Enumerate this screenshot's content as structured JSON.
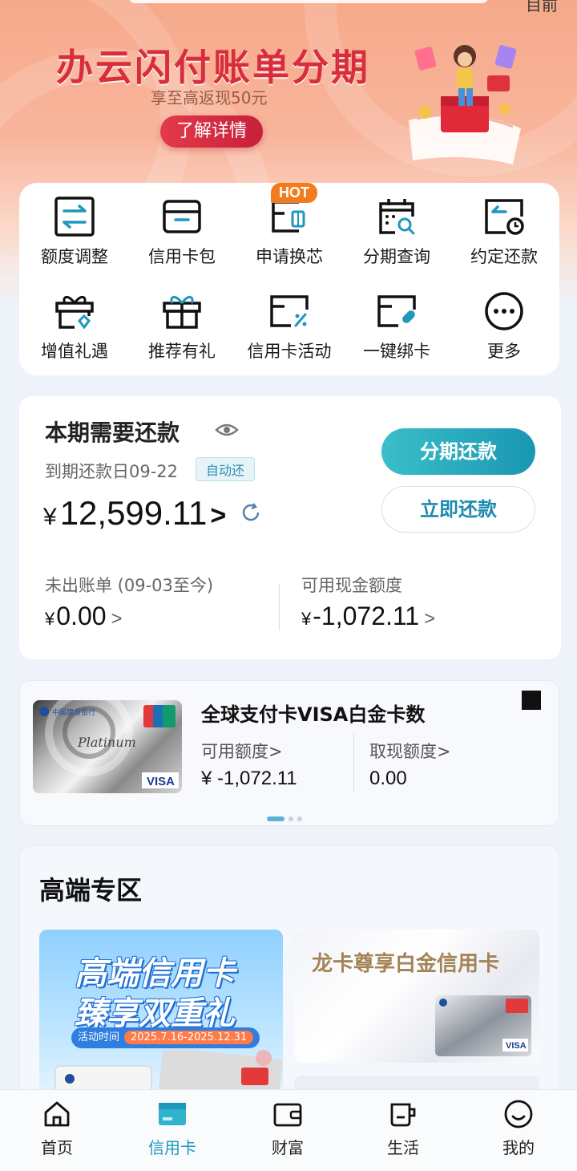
{
  "banner": {
    "title": "办云闪付账单分期",
    "subtitle": "享至高返现50元",
    "button": "了解详情",
    "top_right": "目前"
  },
  "quick_actions": {
    "hot_badge": "HOT",
    "items": [
      {
        "label": "额度调整",
        "icon": "limit-adjust-icon"
      },
      {
        "label": "信用卡包",
        "icon": "card-wallet-icon"
      },
      {
        "label": "申请换芯",
        "icon": "chip-replace-icon"
      },
      {
        "label": "分期查询",
        "icon": "installment-query-icon"
      },
      {
        "label": "约定还款",
        "icon": "scheduled-repay-icon"
      },
      {
        "label": "增值礼遇",
        "icon": "gift-benefit-icon"
      },
      {
        "label": "推荐有礼",
        "icon": "referral-gift-icon"
      },
      {
        "label": "信用卡活动",
        "icon": "card-promo-icon"
      },
      {
        "label": "一键绑卡",
        "icon": "bind-card-icon"
      },
      {
        "label": "更多",
        "icon": "more-icon"
      }
    ]
  },
  "repayment": {
    "title": "本期需要还款",
    "due_label": "到期还款日09-22",
    "auto_badge": "自动还",
    "currency": "¥",
    "amount": "12,599.11",
    "chevron": ">",
    "installment_button": "分期还款",
    "pay_now_button": "立即还款",
    "unbilled_label": "未出账单 (09-03至今)",
    "unbilled_value": "0.00",
    "cash_limit_label": "可用现金额度",
    "cash_limit_value": "-1,072.11",
    "small_chevron": ">"
  },
  "card_strip": {
    "card_name": "全球支付卡VISA白金卡数",
    "available_label": "可用额度>",
    "available_value": "¥  -1,072.11",
    "cash_label": "取现额度>",
    "cash_value": "0.00",
    "card_image_text": {
      "bank": "中国建设银行",
      "tier": "Platinum",
      "network": "VISA",
      "unionpay": "UnionPay 银联"
    },
    "pager": {
      "count": 3,
      "active": 0
    }
  },
  "premium": {
    "title": "高端专区",
    "left_line1": "高端信用卡",
    "left_line2": "臻享双重礼",
    "left_date_label": "活动时间",
    "left_date_value": "2025.7.16-2025.12.31",
    "right_title": "龙卡尊享白金信用卡"
  },
  "tabbar": {
    "items": [
      {
        "label": "首页",
        "icon": "home-icon"
      },
      {
        "label": "信用卡",
        "icon": "credit-card-icon"
      },
      {
        "label": "财富",
        "icon": "wallet-icon"
      },
      {
        "label": "生活",
        "icon": "cup-icon"
      },
      {
        "label": "我的",
        "icon": "smile-icon"
      }
    ],
    "active_index": 1
  },
  "colors": {
    "accent": "#1f98bd",
    "banner_red": "#d82d3c",
    "hot_orange": "#f37b1c"
  }
}
